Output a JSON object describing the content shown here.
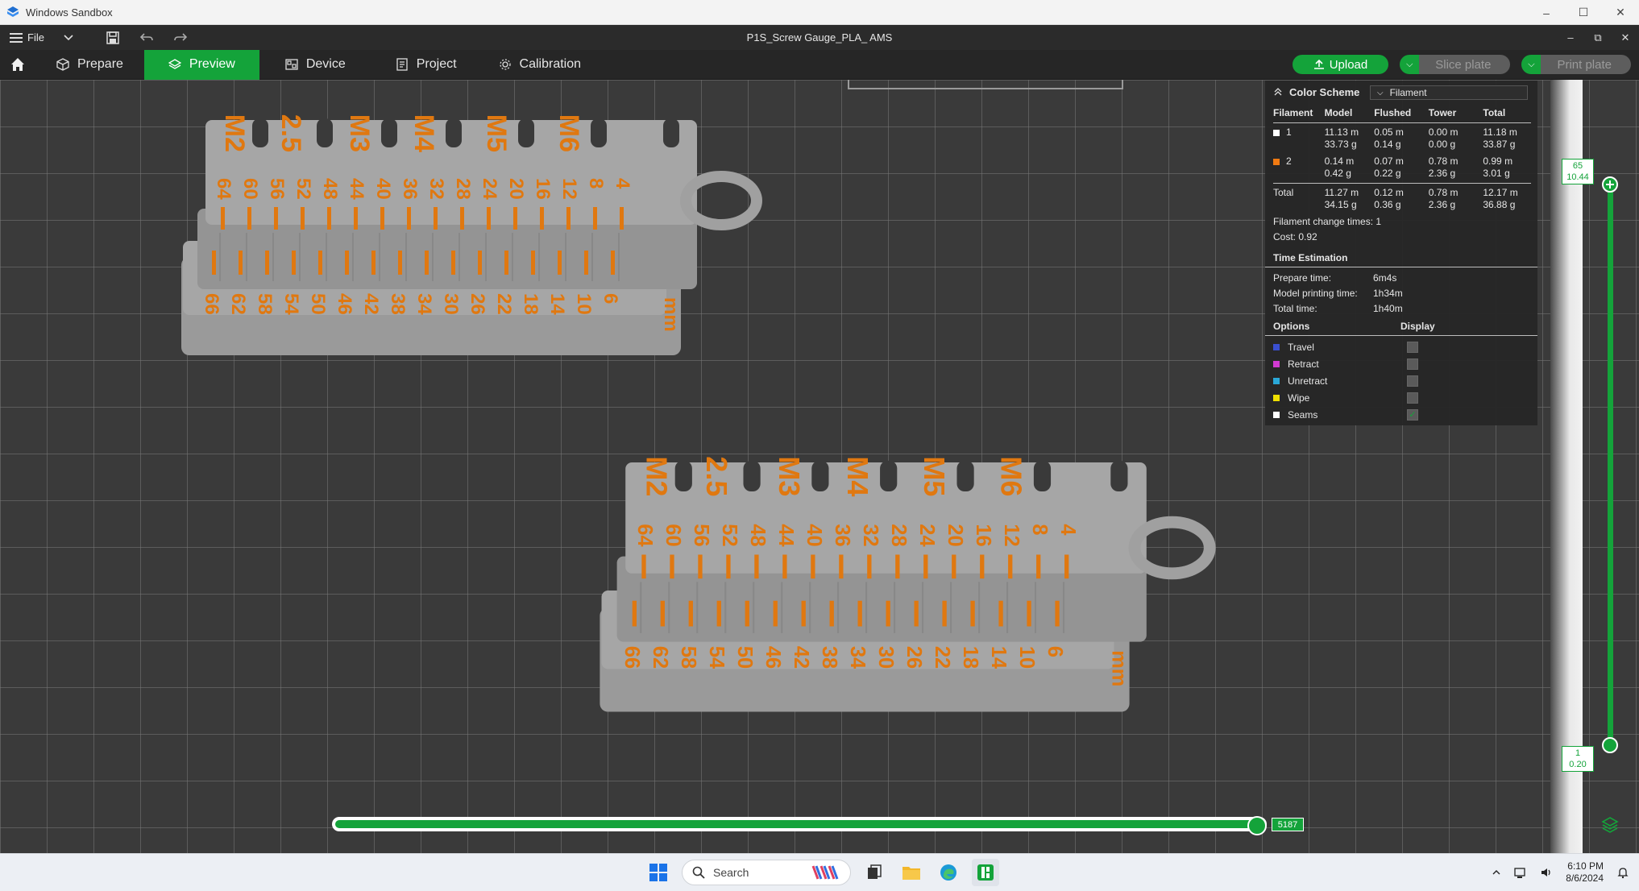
{
  "sandbox": {
    "title": "Windows Sandbox"
  },
  "app": {
    "file_label": "File",
    "title": "P1S_Screw Gauge_PLA_ AMS"
  },
  "toolbar": {
    "tabs": [
      {
        "label": "Prepare"
      },
      {
        "label": "Preview"
      },
      {
        "label": "Device"
      },
      {
        "label": "Project"
      },
      {
        "label": "Calibration"
      }
    ],
    "upload_label": "Upload",
    "slice_label": "Slice plate",
    "print_label": "Print plate"
  },
  "legend": {
    "title": "Color Scheme",
    "scheme_value": "Filament",
    "headers": [
      "Filament",
      "Model",
      "Flushed",
      "Tower",
      "Total"
    ],
    "rows": [
      {
        "id": "1",
        "color": "#ffffff",
        "model": [
          "11.13 m",
          "33.73 g"
        ],
        "flushed": [
          "0.05 m",
          "0.14 g"
        ],
        "tower": [
          "0.00 m",
          "0.00 g"
        ],
        "total": [
          "11.18 m",
          "33.87 g"
        ]
      },
      {
        "id": "2",
        "color": "#f07a12",
        "model": [
          "0.14 m",
          "0.42 g"
        ],
        "flushed": [
          "0.07 m",
          "0.22 g"
        ],
        "tower": [
          "0.78 m",
          "2.36 g"
        ],
        "total": [
          "0.99 m",
          "3.01 g"
        ]
      }
    ],
    "totals": {
      "label": "Total",
      "model": [
        "11.27 m",
        "34.15 g"
      ],
      "flushed": [
        "0.12 m",
        "0.36 g"
      ],
      "tower": [
        "0.78 m",
        "2.36 g"
      ],
      "total": [
        "12.17 m",
        "36.88 g"
      ]
    },
    "change_times": "Filament change times:  1",
    "cost": "Cost:  0.92",
    "time_title": "Time Estimation",
    "prepare_label": "Prepare time:",
    "prepare_value": "6m4s",
    "model_label": "Model printing time:",
    "model_value": "1h34m",
    "total_label": "Total time:",
    "total_value": "1h40m",
    "options_title": "Options",
    "display_title": "Display",
    "options": [
      {
        "label": "Travel",
        "color": "#3a4fd0",
        "checked": false
      },
      {
        "label": "Retract",
        "color": "#d23ad2",
        "checked": false
      },
      {
        "label": "Unretract",
        "color": "#2aa8d8",
        "checked": false
      },
      {
        "label": "Wipe",
        "color": "#f0e000",
        "checked": false
      },
      {
        "label": "Seams",
        "color": "#ffffff",
        "checked": true
      }
    ]
  },
  "vslider": {
    "top_line1": "65",
    "top_line2": "10.44",
    "bottom_line1": "1",
    "bottom_line2": "0.20"
  },
  "hslider": {
    "value": "5187"
  },
  "model": {
    "top_labels": [
      "M2",
      "2.5",
      "M3",
      "M4",
      "M5",
      "M6"
    ],
    "upper_numbers": [
      "64",
      "60",
      "56",
      "52",
      "48",
      "44",
      "40",
      "36",
      "32",
      "28",
      "24",
      "20",
      "16",
      "12",
      "8",
      "4"
    ],
    "lower_numbers": [
      "66",
      "62",
      "58",
      "54",
      "50",
      "46",
      "42",
      "38",
      "34",
      "30",
      "26",
      "22",
      "18",
      "14",
      "10",
      "6"
    ],
    "unit": "mm",
    "color_orange": "#e07810",
    "color_grey": "#a6a6a6"
  },
  "taskbar": {
    "search_placeholder": "Search",
    "time": "6:10 PM",
    "date": "8/6/2024"
  }
}
